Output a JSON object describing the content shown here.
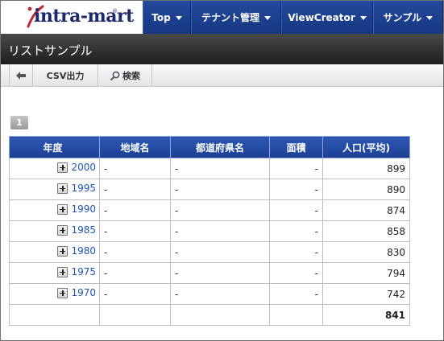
{
  "header": {
    "logo_text": "intra-mart",
    "logo_mark": "®",
    "nav": [
      {
        "label": "Top"
      },
      {
        "label": "テナント管理"
      },
      {
        "label": "ViewCreator"
      },
      {
        "label": "サンプル"
      }
    ]
  },
  "page": {
    "title": "リストサンプル"
  },
  "toolbar": {
    "back_icon": "arrow-left-icon",
    "csv_label": "CSV出力",
    "search_label": "検索",
    "search_icon": "magnifier-icon"
  },
  "pager": {
    "current_page": "1"
  },
  "table": {
    "columns": [
      "年度",
      "地域名",
      "都道府県名",
      "面積",
      "人口(平均)"
    ],
    "rows": [
      {
        "year": "2000",
        "region": "-",
        "prefecture": "-",
        "area": "-",
        "population": "899"
      },
      {
        "year": "1995",
        "region": "-",
        "prefecture": "-",
        "area": "-",
        "population": "890"
      },
      {
        "year": "1990",
        "region": "-",
        "prefecture": "-",
        "area": "-",
        "population": "874"
      },
      {
        "year": "1985",
        "region": "-",
        "prefecture": "-",
        "area": "-",
        "population": "858"
      },
      {
        "year": "1980",
        "region": "-",
        "prefecture": "-",
        "area": "-",
        "population": "830"
      },
      {
        "year": "1975",
        "region": "-",
        "prefecture": "-",
        "area": "-",
        "population": "794"
      },
      {
        "year": "1970",
        "region": "-",
        "prefecture": "-",
        "area": "-",
        "population": "742"
      }
    ],
    "total_population": "841"
  },
  "colors": {
    "nav_bg": "#1c3f8f",
    "title_bar_bg": "#2a2a2a",
    "table_header_bg": "#2048a3",
    "link": "#1f55b8"
  }
}
